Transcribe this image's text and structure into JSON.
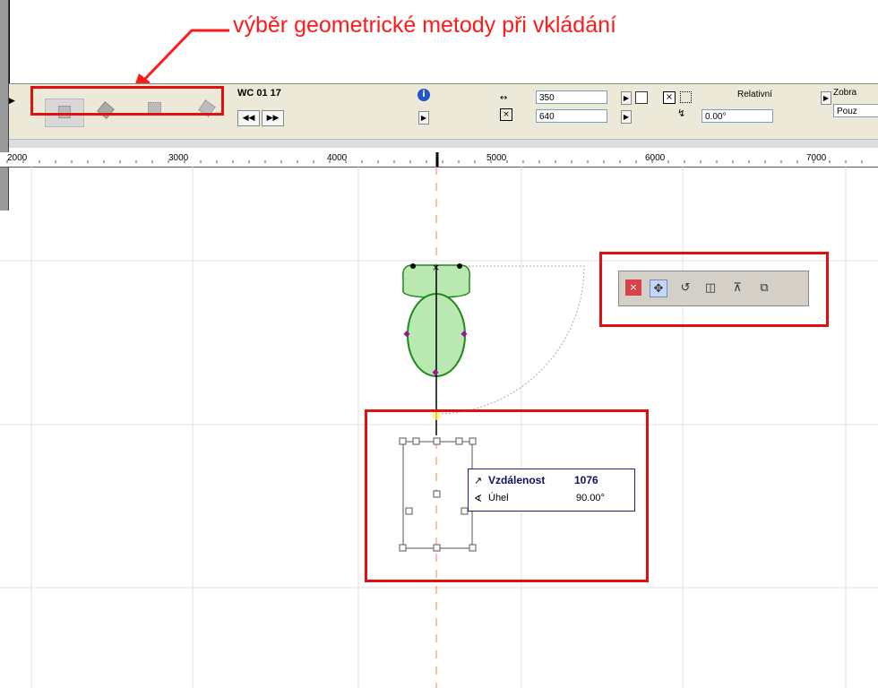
{
  "annotation": {
    "text": "výběr geometrické metody při vkládání"
  },
  "infobox": {
    "object_name": "WC 01 17",
    "width_value": "350",
    "height_value": "640",
    "relative_label": "Relativní",
    "angle_value": "0.00°",
    "display_label": "Zobra",
    "display_value": "Pouz",
    "geometry_methods": [
      "orthogonal-method-icon",
      "rotated-method-icon",
      "diagonal-method-icon",
      "rotated-diagonal-method-icon"
    ]
  },
  "ruler": {
    "labels": [
      "2000",
      "3000",
      "4000",
      "5000",
      "6000",
      "7000"
    ]
  },
  "pet_palette": {
    "tools": [
      "close-icon",
      "drag-icon",
      "rotate-icon",
      "mirror-icon",
      "elevate-icon",
      "multiply-icon"
    ]
  },
  "tracker": {
    "distance_label": "Vzdálenost",
    "distance_value": "1076",
    "angle_label": "Úhel",
    "angle_value": "90.00°"
  },
  "colors": {
    "highlight_red": "#e01010",
    "annotation_red": "#ff1a1a",
    "object_fill": "#b9e8b0",
    "object_stroke": "#1f8a1f",
    "tracker_border": "#1a237e"
  }
}
